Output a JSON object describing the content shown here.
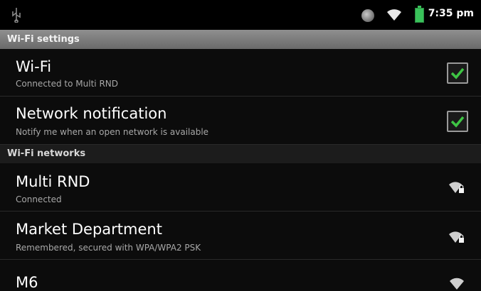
{
  "status_bar": {
    "time": "7:35 pm",
    "icons": [
      "usb-icon",
      "globe-icon",
      "wifi-icon",
      "battery-icon"
    ]
  },
  "sections": {
    "wifi_settings": "Wi-Fi settings",
    "wifi_networks": "Wi-Fi networks"
  },
  "settings": [
    {
      "title": "Wi-Fi",
      "subtitle": "Connected to Multi RND",
      "checked": true
    },
    {
      "title": "Network notification",
      "subtitle": "Notify me when an open network is available",
      "checked": true
    }
  ],
  "networks": [
    {
      "name": "Multi RND",
      "status": "Connected",
      "icon": "wifi-secured-icon"
    },
    {
      "name": "Market Department",
      "status": "Remembered, secured with WPA/WPA2 PSK",
      "icon": "wifi-secured-icon"
    },
    {
      "name": "M6",
      "status": "",
      "icon": "wifi-icon"
    }
  ],
  "colors": {
    "background": "#0c0c0c",
    "check_green": "#3ec544",
    "section_header": "#7a7a7a"
  }
}
